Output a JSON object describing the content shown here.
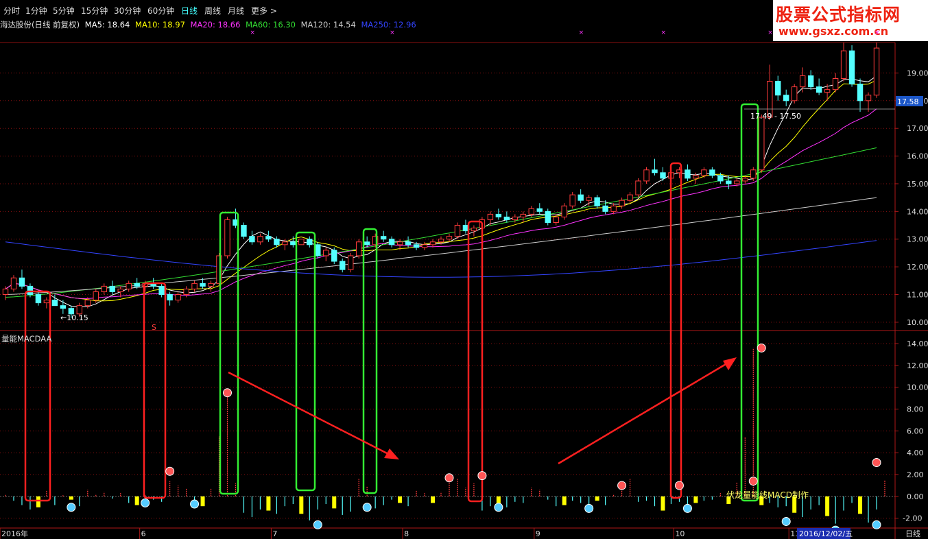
{
  "toolbar": {
    "periods": [
      "分时",
      "1分钟",
      "5分钟",
      "15分钟",
      "30分钟",
      "60分钟",
      "日线",
      "周线",
      "月线",
      "更多 >"
    ],
    "active": "日线"
  },
  "info": {
    "title": "海达股份(日线 前复权)",
    "ma5": "MA5: 18.64",
    "ma10": "MA10: 18.97",
    "ma20": "MA20: 18.66",
    "ma60": "MA60: 16.30",
    "ma120": "MA120: 14.54",
    "ma250": "MA250: 12.96"
  },
  "logo": {
    "line1": "股票公式指标网",
    "line2": "www.gsxz.com.cn"
  },
  "colors": {
    "up": "#ff3b3b",
    "down": "#54ffff",
    "ma5": "#ffffff",
    "ma10": "#ffff00",
    "ma20": "#ff33ff",
    "ma60": "#33dd33",
    "ma120": "#cccccc",
    "ma250": "#3344ff",
    "grid": "#8a1010",
    "box_red": "#ff2020",
    "box_green": "#33ee33"
  },
  "price_axis": {
    "labels": [
      "19.00",
      "18.00",
      "17.00",
      "16.00",
      "15.00",
      "14.00",
      "13.00",
      "12.00",
      "11.00",
      "10.00"
    ],
    "current": "17.58"
  },
  "macd_axis": {
    "labels": [
      "14.00",
      "12.00",
      "10.00",
      "8.00",
      "6.00",
      "4.00",
      "2.00",
      "0.00",
      "-2.00"
    ]
  },
  "annotations": {
    "low": "←10.15",
    "range": "17.49 - 17.50",
    "indicator_name": "量能MACDAA",
    "credit": "伏龙量能线MACD制作",
    "sell_mark": "S"
  },
  "time_axis": {
    "labels": [
      "2016年",
      "6",
      "7",
      "8",
      "9",
      "10",
      "11"
    ],
    "date_box": "2016/12/02/五",
    "period": "日线"
  },
  "chart_data": {
    "type": "candlestick",
    "title": "海达股份(日线 前复权)",
    "price_range": [
      9.7,
      20.1
    ],
    "macd_range": [
      -2.9,
      15.2
    ],
    "candles": [
      [
        11.0,
        11.3,
        10.8,
        11.2
      ],
      [
        11.2,
        11.7,
        11.1,
        11.6
      ],
      [
        11.6,
        11.9,
        11.2,
        11.3
      ],
      [
        11.3,
        11.4,
        10.9,
        11.0
      ],
      [
        11.0,
        11.1,
        10.6,
        10.7
      ],
      [
        10.7,
        10.9,
        10.5,
        10.8
      ],
      [
        10.8,
        11.0,
        10.6,
        10.6
      ],
      [
        10.6,
        10.8,
        10.3,
        10.5
      ],
      [
        10.5,
        10.6,
        10.15,
        10.3
      ],
      [
        10.3,
        10.7,
        10.2,
        10.6
      ],
      [
        10.6,
        10.9,
        10.5,
        10.8
      ],
      [
        10.8,
        11.2,
        10.7,
        11.1
      ],
      [
        11.1,
        11.4,
        11.0,
        11.3
      ],
      [
        11.3,
        11.5,
        11.0,
        11.1
      ],
      [
        11.1,
        11.3,
        10.9,
        11.2
      ],
      [
        11.2,
        11.5,
        11.1,
        11.4
      ],
      [
        11.4,
        11.6,
        11.2,
        11.3
      ],
      [
        11.3,
        11.5,
        11.1,
        11.4
      ],
      [
        11.4,
        11.6,
        11.2,
        11.3
      ],
      [
        11.3,
        11.4,
        10.9,
        11.0
      ],
      [
        11.0,
        11.1,
        10.6,
        10.8
      ],
      [
        10.8,
        11.1,
        10.7,
        11.0
      ],
      [
        11.0,
        11.3,
        10.9,
        11.2
      ],
      [
        11.2,
        11.5,
        11.1,
        11.4
      ],
      [
        11.4,
        11.6,
        11.2,
        11.3
      ],
      [
        11.3,
        11.5,
        11.1,
        11.4
      ],
      [
        11.4,
        12.5,
        11.3,
        12.4
      ],
      [
        12.4,
        13.8,
        12.3,
        13.7
      ],
      [
        13.7,
        14.1,
        13.4,
        13.5
      ],
      [
        13.5,
        13.6,
        13.0,
        13.1
      ],
      [
        13.1,
        13.3,
        12.8,
        12.9
      ],
      [
        12.9,
        13.2,
        12.8,
        13.1
      ],
      [
        13.1,
        13.3,
        12.9,
        13.0
      ],
      [
        13.0,
        13.1,
        12.7,
        12.8
      ],
      [
        12.8,
        13.0,
        12.6,
        12.9
      ],
      [
        12.9,
        13.1,
        12.7,
        12.8
      ],
      [
        12.8,
        13.0,
        12.8,
        13.0
      ],
      [
        13.0,
        13.1,
        12.7,
        12.8
      ],
      [
        12.8,
        12.9,
        12.3,
        12.4
      ],
      [
        12.4,
        12.7,
        12.2,
        12.6
      ],
      [
        12.6,
        12.7,
        12.1,
        12.2
      ],
      [
        12.2,
        12.3,
        11.8,
        11.9
      ],
      [
        11.9,
        12.5,
        11.8,
        12.4
      ],
      [
        12.4,
        13.0,
        12.3,
        12.9
      ],
      [
        12.9,
        13.1,
        12.7,
        12.8
      ],
      [
        12.8,
        13.2,
        12.7,
        13.1
      ],
      [
        13.1,
        13.3,
        12.9,
        13.0
      ],
      [
        13.0,
        13.1,
        12.7,
        12.8
      ],
      [
        12.8,
        13.0,
        12.6,
        12.9
      ],
      [
        12.9,
        13.1,
        12.7,
        12.8
      ],
      [
        12.8,
        12.9,
        12.6,
        12.7
      ],
      [
        12.7,
        12.9,
        12.6,
        12.8
      ],
      [
        12.8,
        13.0,
        12.7,
        12.9
      ],
      [
        12.9,
        13.1,
        12.8,
        13.0
      ],
      [
        13.0,
        13.2,
        12.9,
        13.1
      ],
      [
        13.1,
        13.6,
        13.0,
        13.5
      ],
      [
        13.5,
        13.7,
        13.2,
        13.3
      ],
      [
        13.3,
        13.5,
        13.1,
        13.4
      ],
      [
        13.4,
        13.8,
        13.3,
        13.7
      ],
      [
        13.7,
        14.0,
        13.5,
        13.9
      ],
      [
        13.9,
        14.1,
        13.7,
        13.8
      ],
      [
        13.8,
        14.0,
        13.6,
        13.7
      ],
      [
        13.7,
        13.9,
        13.6,
        13.8
      ],
      [
        13.8,
        14.0,
        13.6,
        13.9
      ],
      [
        13.9,
        14.2,
        13.8,
        14.1
      ],
      [
        14.1,
        14.3,
        13.9,
        14.0
      ],
      [
        14.0,
        14.1,
        13.5,
        13.6
      ],
      [
        13.6,
        13.9,
        13.5,
        13.8
      ],
      [
        13.8,
        14.3,
        13.7,
        14.2
      ],
      [
        14.2,
        14.7,
        14.1,
        14.6
      ],
      [
        14.6,
        14.8,
        14.3,
        14.4
      ],
      [
        14.4,
        14.6,
        14.2,
        14.5
      ],
      [
        14.5,
        14.6,
        14.1,
        14.2
      ],
      [
        14.2,
        14.4,
        13.9,
        14.0
      ],
      [
        14.0,
        14.3,
        13.9,
        14.2
      ],
      [
        14.2,
        14.5,
        14.1,
        14.4
      ],
      [
        14.4,
        14.7,
        14.3,
        14.6
      ],
      [
        14.6,
        15.2,
        14.5,
        15.1
      ],
      [
        15.1,
        15.6,
        15.0,
        15.5
      ],
      [
        15.5,
        15.9,
        15.3,
        15.4
      ],
      [
        15.4,
        15.6,
        15.1,
        15.2
      ],
      [
        15.2,
        15.5,
        15.1,
        15.4
      ],
      [
        15.4,
        15.6,
        15.2,
        15.5
      ],
      [
        15.5,
        15.7,
        15.1,
        15.2
      ],
      [
        15.2,
        15.4,
        15.0,
        15.3
      ],
      [
        15.3,
        15.6,
        15.2,
        15.5
      ],
      [
        15.5,
        15.6,
        15.2,
        15.3
      ],
      [
        15.3,
        15.4,
        15.0,
        15.1
      ],
      [
        15.1,
        15.3,
        14.8,
        15.0
      ],
      [
        15.0,
        15.2,
        14.9,
        15.1
      ],
      [
        15.1,
        15.3,
        15.0,
        15.2
      ],
      [
        15.2,
        15.6,
        15.1,
        15.5
      ],
      [
        15.5,
        17.5,
        15.4,
        17.4
      ],
      [
        17.4,
        19.3,
        17.3,
        18.7
      ],
      [
        18.7,
        18.9,
        18.0,
        18.2
      ],
      [
        18.2,
        18.4,
        17.8,
        18.0
      ],
      [
        18.0,
        18.6,
        17.9,
        18.5
      ],
      [
        18.5,
        19.2,
        18.3,
        18.9
      ],
      [
        18.9,
        19.1,
        18.4,
        18.5
      ],
      [
        18.5,
        18.8,
        18.2,
        18.3
      ],
      [
        18.3,
        18.6,
        18.0,
        18.4
      ],
      [
        18.4,
        19.0,
        18.3,
        18.8
      ],
      [
        18.8,
        20.1,
        18.7,
        19.8
      ],
      [
        19.8,
        20.0,
        18.5,
        18.6
      ],
      [
        18.6,
        18.8,
        17.6,
        18.0
      ],
      [
        18.0,
        18.3,
        17.6,
        18.2
      ],
      [
        18.2,
        20.1,
        18.1,
        19.9
      ]
    ],
    "macd_bars": [
      0.2,
      -0.4,
      -0.8,
      -1.2,
      -1.0,
      0.5,
      -0.8,
      0.1,
      -0.3,
      -0.9,
      0.6,
      0.2,
      0.4,
      -0.2,
      0.3,
      -0.6,
      -0.8,
      0.2,
      -0.3,
      -0.5,
      1.4,
      1.0,
      0.7,
      -0.8,
      -0.9,
      0.7,
      5.5,
      9.5,
      1.2,
      -1.5,
      -1.9,
      -1.2,
      -1.3,
      -1.6,
      -0.9,
      -0.7,
      -1.6,
      -2.2,
      -1.2,
      -0.7,
      -1.1,
      -1.7,
      -1.4,
      1.6,
      0.9,
      -1.1,
      -0.8,
      -0.3,
      -0.6,
      -0.9,
      0.5,
      0.3,
      -0.6,
      0.4,
      1.4,
      1.6,
      0.8,
      1.2,
      -1.3,
      -0.9,
      -0.7,
      -1.0,
      -0.5,
      -0.6,
      0.8,
      0.6,
      -0.3,
      -0.9,
      -0.8,
      -0.4,
      -0.6,
      -1.0,
      -0.4,
      -0.8,
      0.2,
      1.1,
      1.6,
      -0.5,
      -0.4,
      -0.9,
      -1.3,
      -0.7,
      -0.5,
      -0.9,
      -0.6,
      -0.4,
      -0.3,
      0.3,
      -0.7,
      1.3,
      5.4,
      13.6,
      -0.8,
      -0.6,
      -1.0,
      -0.9,
      -1.5,
      -1.9,
      -1.2,
      -0.8,
      -1.8,
      -2.5,
      -1.3,
      -0.6,
      -1.6,
      -2.4,
      -1.2,
      1.5
    ]
  }
}
